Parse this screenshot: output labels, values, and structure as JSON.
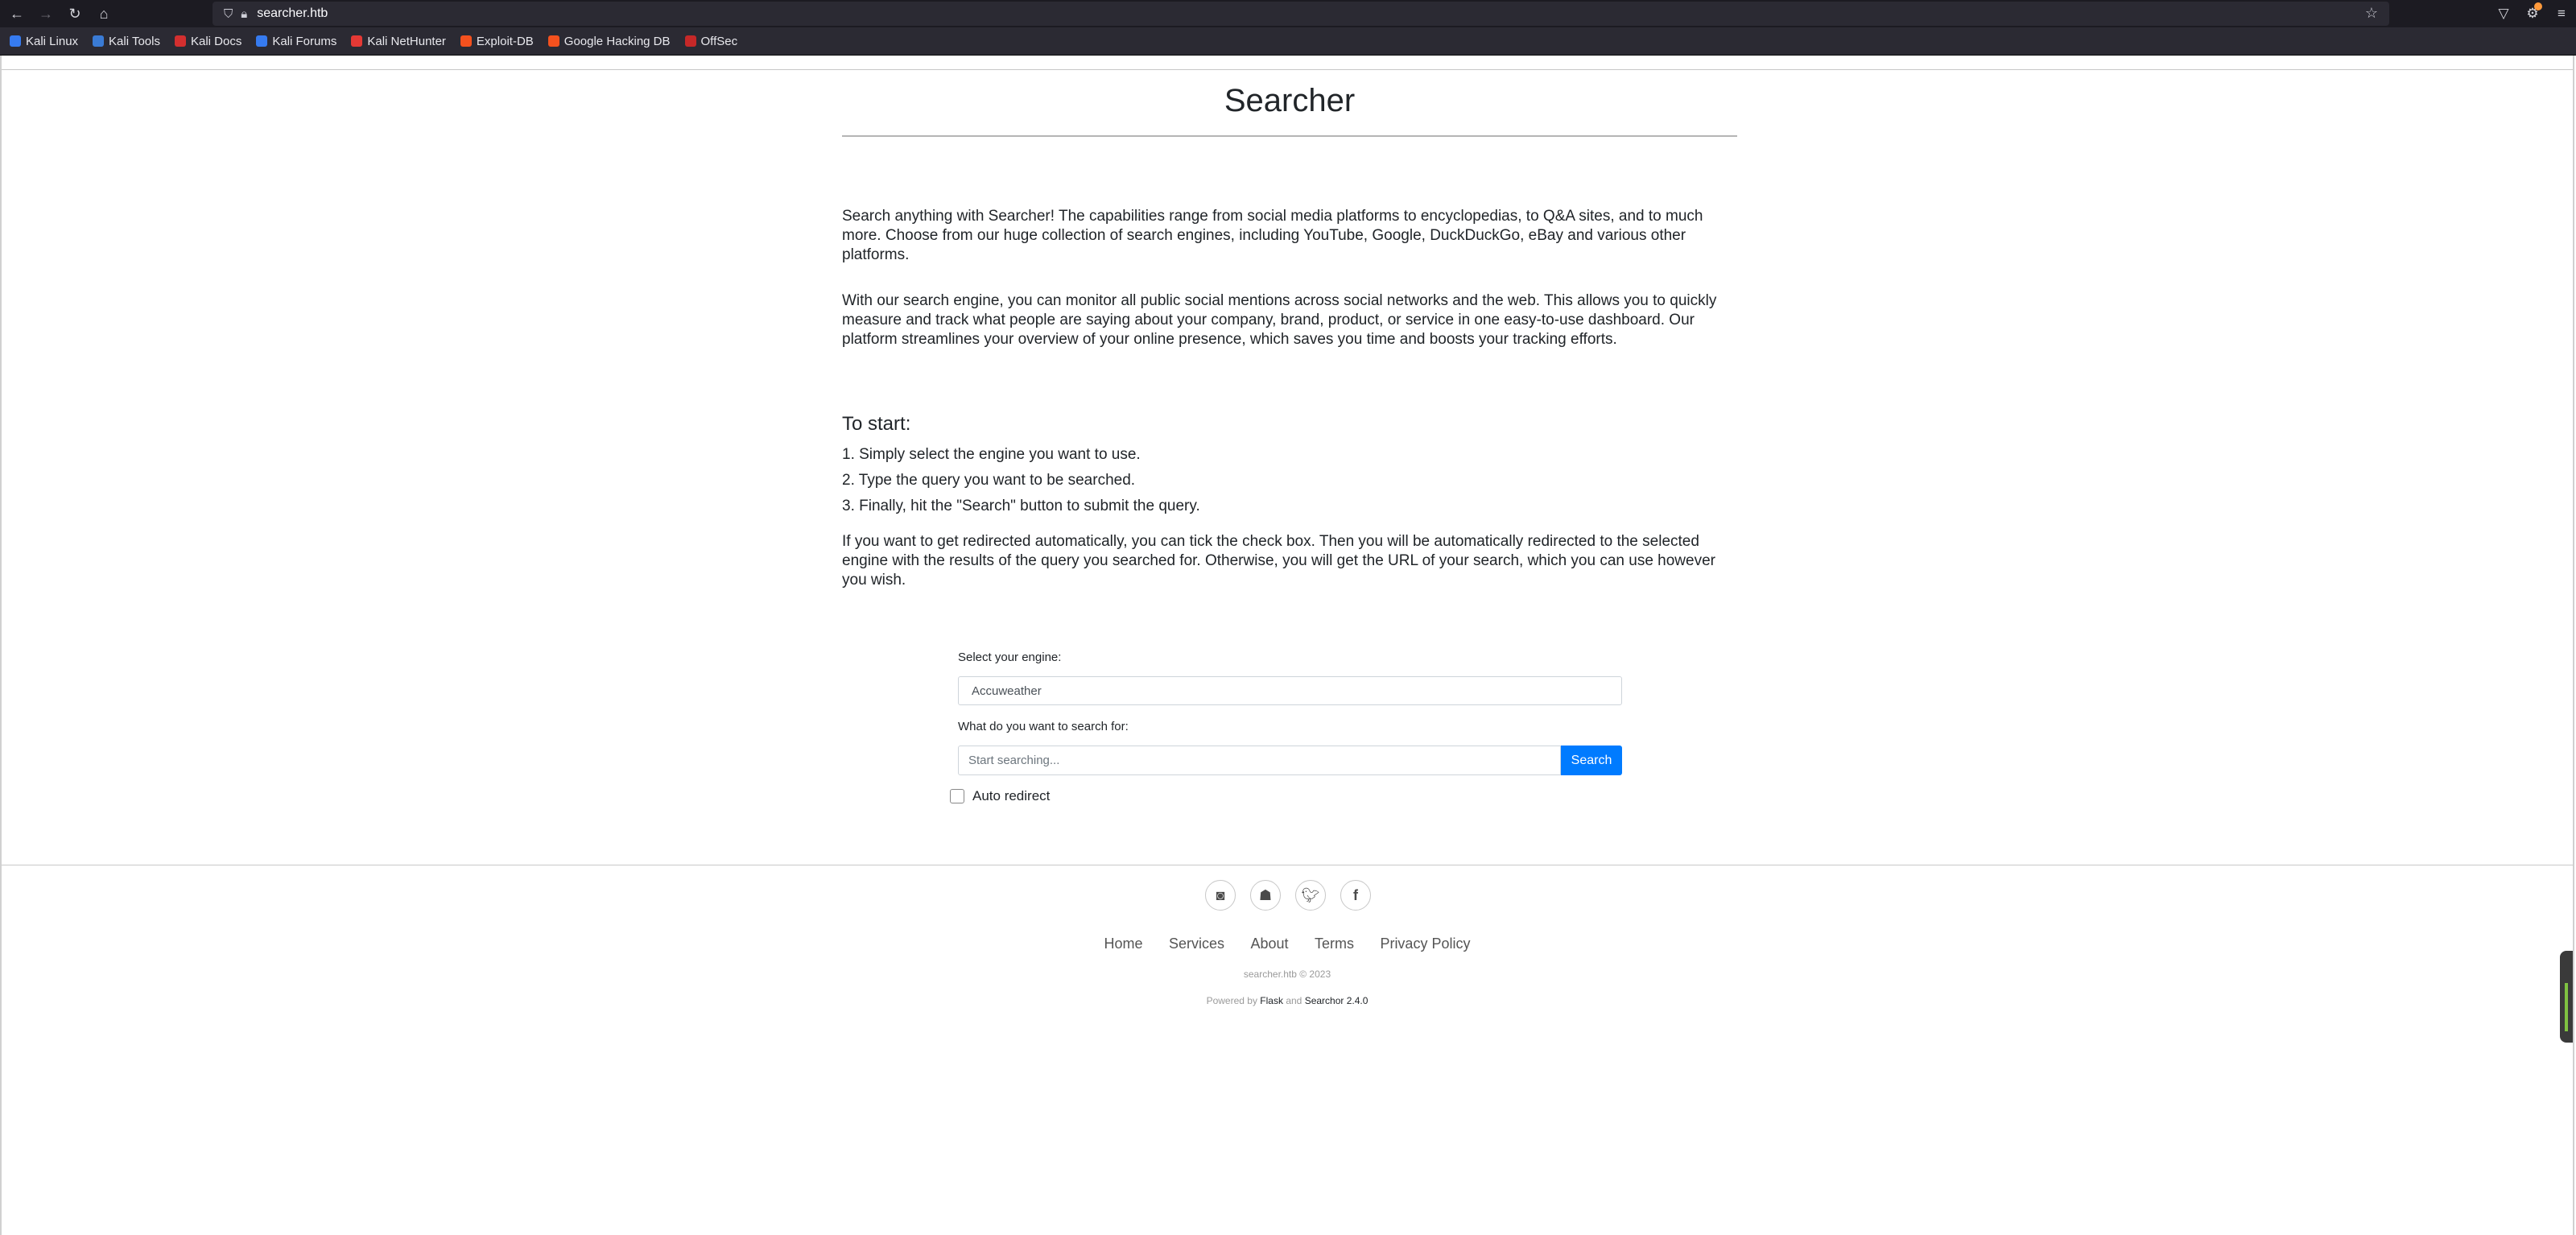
{
  "browser": {
    "url": "searcher.htb",
    "bookmarks": [
      {
        "label": "Kali Linux",
        "color": "#367bf0"
      },
      {
        "label": "Kali Tools",
        "color": "#3a7bd5"
      },
      {
        "label": "Kali Docs",
        "color": "#d32f2f"
      },
      {
        "label": "Kali Forums",
        "color": "#367bf0"
      },
      {
        "label": "Kali NetHunter",
        "color": "#e53935"
      },
      {
        "label": "Exploit-DB",
        "color": "#f4511e"
      },
      {
        "label": "Google Hacking DB",
        "color": "#f4511e"
      },
      {
        "label": "OffSec",
        "color": "#c62828"
      }
    ]
  },
  "page": {
    "title": "Searcher",
    "intro_1": "Search anything with Searcher! The capabilities range from social media platforms to encyclopedias, to Q&A sites, and to much more. Choose from our huge collection of search engines, including YouTube, Google, DuckDuckGo, eBay and various other platforms.",
    "intro_2": "With our search engine, you can monitor all public social mentions across social networks and the web. This allows you to quickly measure and track what people are saying about your company, brand, product, or service in one easy-to-use dashboard. Our platform streamlines your overview of your online presence, which saves you time and boosts your tracking efforts.",
    "to_start": "To start:",
    "steps": [
      "1. Simply select the engine you want to use.",
      "2. Type the query you want to be searched.",
      "3. Finally, hit the \"Search\" button to submit the query."
    ],
    "redirect_note": "If you want to get redirected automatically, you can tick the check box. Then you will be automatically redirected to the selected engine with the results of the query you searched for. Otherwise, you will get the URL of your search, which you can use however you wish."
  },
  "form": {
    "engine_label": "Select your engine:",
    "engine_value": "Accuweather",
    "query_label": "What do you want to search for:",
    "query_placeholder": "Start searching...",
    "search_button": "Search",
    "auto_redirect_label": "Auto redirect",
    "auto_redirect_checked": false
  },
  "footer": {
    "links": [
      "Home",
      "Services",
      "About",
      "Terms",
      "Privacy Policy"
    ],
    "copyright": "searcher.htb © 2023",
    "powered_prefix": "Powered by",
    "powered_flask": "Flask",
    "powered_and": "and",
    "powered_searchor": "Searchor 2.4.0",
    "social_icons": [
      "instagram-icon",
      "snapchat-icon",
      "twitter-icon",
      "facebook-icon"
    ]
  }
}
